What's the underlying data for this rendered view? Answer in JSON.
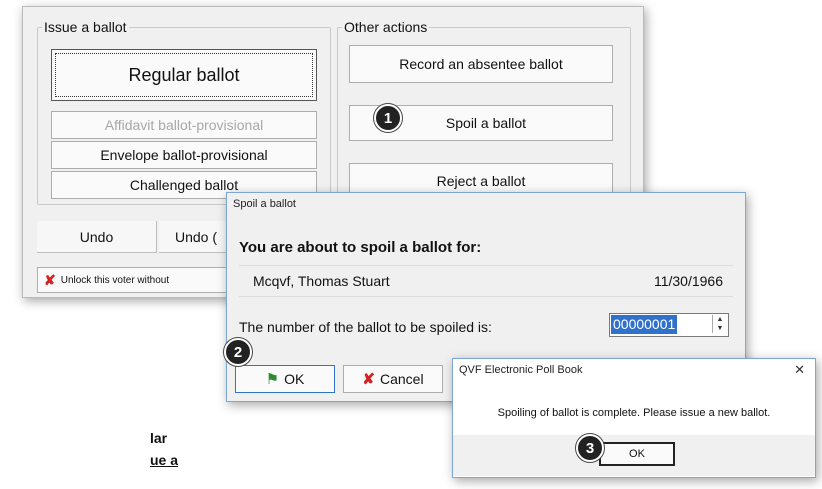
{
  "main_window": {
    "issue_group_label": "Issue a ballot",
    "regular_ballot": "Regular ballot",
    "affidavit_ballot": "Affidavit ballot-provisional",
    "envelope_ballot": "Envelope ballot-provisional",
    "challenged_ballot": "Challenged ballot",
    "other_group_label": "Other actions",
    "record_absentee": "Record an absentee ballot",
    "spoil_ballot": "Spoil a ballot",
    "reject_ballot": "Reject a ballot",
    "undo_1": "Undo",
    "undo_2": "Undo (",
    "unlock_voter": "Unlock this voter without"
  },
  "spoil_dialog": {
    "title": "Spoil a ballot",
    "heading": "You are about to spoil a ballot for:",
    "voter_name": "Mcqvf, Thomas Stuart",
    "voter_dob": "11/30/1966",
    "number_label": "The number of the ballot to be spoiled is:",
    "ballot_number": "00000001",
    "ok_label": "OK",
    "cancel_label": "Cancel"
  },
  "confirm_dialog": {
    "title": "QVF Electronic Poll Book",
    "message": "Spoiling of ballot is complete. Please issue a new ballot.",
    "ok_label": "OK",
    "close_glyph": "✕"
  },
  "callouts": {
    "one": "1",
    "two": "2",
    "three": "3"
  },
  "background_text": {
    "line1": "lar",
    "line2": "ue a"
  },
  "colors": {
    "accent_blue": "#3072c9",
    "cancel_red": "#d42222",
    "ok_green": "#2e8b2e"
  }
}
